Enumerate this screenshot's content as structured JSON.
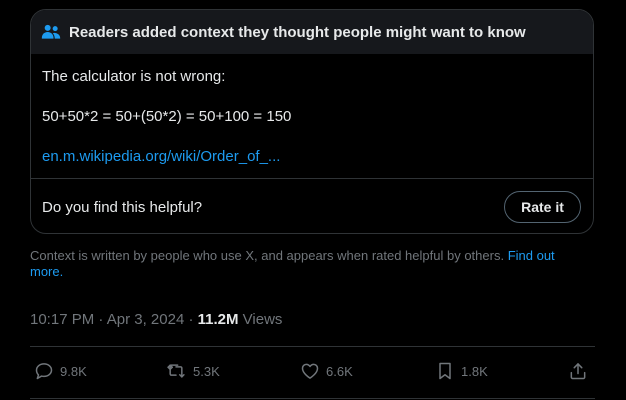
{
  "note": {
    "header": "Readers added context they thought people might want to know",
    "line1": "The calculator is not wrong:",
    "line2": "50+50*2 = 50+(50*2) = 50+100 = 150",
    "link": "en.m.wikipedia.org/wiki/Order_of_...",
    "helpful_question": "Do you find this helpful?",
    "rate_button": "Rate it"
  },
  "disclaimer": {
    "text": "Context is written by people who use X, and appears when rated helpful by others. ",
    "link": "Find out more."
  },
  "meta": {
    "time": "10:17 PM",
    "separator1": " · ",
    "date": "Apr 3, 2024",
    "separator2": " · ",
    "views_count": "11.2M",
    "views_label": " Views"
  },
  "actions": {
    "reply": {
      "count": "9.8K",
      "icon": "reply-icon"
    },
    "repost": {
      "count": "5.3K",
      "icon": "repost-icon"
    },
    "like": {
      "count": "6.6K",
      "icon": "heart-icon"
    },
    "bookmark": {
      "count": "1.8K",
      "icon": "bookmark-icon"
    },
    "share": {
      "icon": "share-icon"
    }
  },
  "colors": {
    "background": "#000000",
    "header_bg": "#16181c",
    "text": "#e7e9ea",
    "muted": "#71767b",
    "accent": "#1d9bf0",
    "border": "#2f3336"
  }
}
